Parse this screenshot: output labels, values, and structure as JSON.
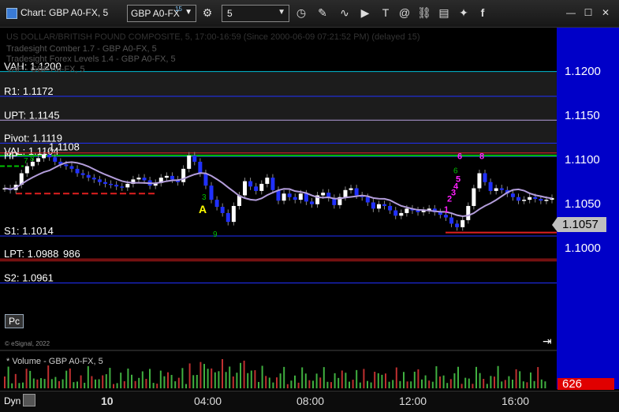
{
  "window": {
    "title": "Chart: GBP A0-FX, 5"
  },
  "toolbar": {
    "symbol": "GBP A0-FX",
    "symbol_suffix": "15",
    "interval": "5",
    "icons": [
      "settings-gear-icon",
      "clock-icon",
      "pencil-icon",
      "line-draw-icon",
      "play-icon",
      "text-tool-icon",
      "at-symbol-icon",
      "link-icon",
      "clipboard-icon",
      "twitter-icon",
      "facebook-icon"
    ]
  },
  "window_controls": {
    "minimize": "—",
    "maximize": "☐",
    "close": "✕"
  },
  "chart_info": {
    "header_text": "US DOLLAR/BRITISH POUND COMPOSITE, 5, 17:00-16:59 (Since 2000-06-09 07:21:52 PM) (delayed 15)",
    "studies": [
      "Tradesight Comber 1.7 - GBP A0-FX, 5",
      "Tradesight Forex Levels 1.4 - GBP A0-FX, 5",
      "VAP - GBP A0-FX, 5"
    ],
    "pc_button": "Pc",
    "copyright": "© eSignal, 2022",
    "volume_title": "* Volume - GBP A0-FX, 5",
    "mode": "Dyn"
  },
  "chart_data": {
    "type": "candlestick",
    "x_ticks": [
      "10",
      "04:00",
      "08:00",
      "12:00",
      "16:00"
    ],
    "y_ticks": [
      "1.1200",
      "1.1150",
      "1.1100",
      "1.1050",
      "1.1000"
    ],
    "ylim": [
      1.0915,
      1.123
    ],
    "last_price": "1.1057",
    "volume_last": "626",
    "levels": [
      {
        "label": "VAH: 1.1200",
        "value": 1.12
      },
      {
        "label": "R1: 1.1172",
        "value": 1.1172
      },
      {
        "label": "UPT: 1.1145",
        "value": 1.1145
      },
      {
        "label": "Pivot: 1.1119",
        "value": 1.1119
      },
      {
        "label": "VAL: 1.1104",
        "value": 1.1104
      },
      {
        "label": "S1: 1.1014",
        "value": 1.1014
      },
      {
        "label": "LPT: 1.0988",
        "value": 1.0988
      },
      {
        "label": "S2: 1.0961",
        "value": 1.0961
      }
    ],
    "overlapping_fragments": [
      "HP",
      "1.1108",
      "986"
    ],
    "annotations": {
      "marker_A": "A",
      "green_counts": [
        "7",
        "8",
        "9",
        "3",
        "6"
      ],
      "magenta_counts": [
        "1",
        "2",
        "3",
        "4",
        "5",
        "6",
        "8"
      ]
    },
    "price_path": [
      1.1068,
      1.1066,
      1.1072,
      1.1085,
      1.1093,
      1.1098,
      1.1102,
      1.1106,
      1.1103,
      1.1098,
      1.1095,
      1.1093,
      1.109,
      1.1085,
      1.1083,
      1.108,
      1.1078,
      1.1075,
      1.1073,
      1.1072,
      1.107,
      1.1069,
      1.1073,
      1.1078,
      1.108,
      1.1077,
      1.1071,
      1.1074,
      1.108,
      1.1082,
      1.1078,
      1.1075,
      1.109,
      1.1105,
      1.1098,
      1.1085,
      1.1071,
      1.1055,
      1.1047,
      1.104,
      1.103,
      1.1048,
      1.106,
      1.1076,
      1.107,
      1.1065,
      1.1073,
      1.108,
      1.1066,
      1.1054,
      1.1062,
      1.1058,
      1.1055,
      1.1062,
      1.1053,
      1.105,
      1.106,
      1.1063,
      1.1057,
      1.1049,
      1.1058,
      1.1066,
      1.1068,
      1.106,
      1.1058,
      1.1052,
      1.1045,
      1.105,
      1.1048,
      1.1043,
      1.1037,
      1.104,
      1.1045,
      1.1043,
      1.1041,
      1.1043,
      1.1045,
      1.1041,
      1.1038,
      1.1035,
      1.1028,
      1.1024,
      1.1032,
      1.1048,
      1.1068,
      1.1085,
      1.1075,
      1.1065,
      1.1068,
      1.1066,
      1.1062,
      1.1058,
      1.1054,
      1.1055,
      1.1058,
      1.1056,
      1.1054,
      1.1055,
      1.1057
    ]
  },
  "colors": {
    "background": "#000000",
    "axis": "#0000c8",
    "up": "#ffffff",
    "down": "#2030ff",
    "vwap": "#b39ddb",
    "volume": "#40b040"
  }
}
